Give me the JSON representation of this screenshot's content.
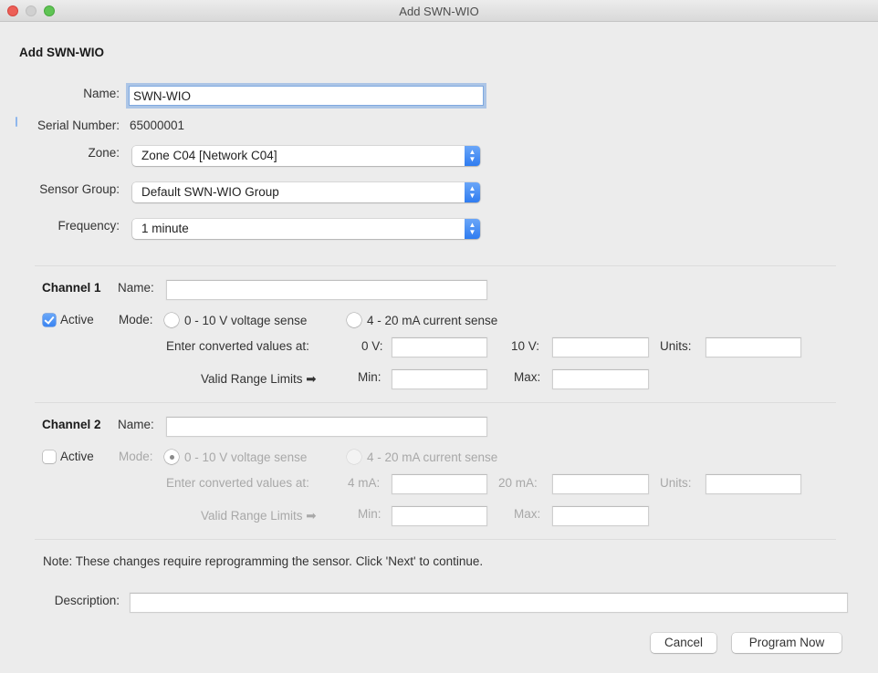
{
  "window": {
    "title": "Add SWN-WIO",
    "controls": [
      "close",
      "minimize",
      "zoom"
    ]
  },
  "heading": "Add SWN-WIO",
  "form": {
    "name": {
      "label": "Name:",
      "value": "SWN-WIO"
    },
    "serial_number": {
      "label": "Serial Number:",
      "value": "65000001"
    },
    "zone": {
      "label": "Zone:",
      "selected": "Zone C04 [Network C04]"
    },
    "sensor_group": {
      "label": "Sensor Group:",
      "selected": "Default SWN-WIO Group"
    },
    "frequency": {
      "label": "Frequency:",
      "selected": "1 minute"
    },
    "select_arrows_glyph": "⌃⌄"
  },
  "channels": [
    {
      "title": "Channel 1",
      "name_label": "Name:",
      "name_value": "",
      "active_label": "Active",
      "active": true,
      "mode_label": "Mode:",
      "modes": [
        {
          "label": "0 - 10 V voltage sense",
          "selected": false
        },
        {
          "label": "4 - 20 mA current sense",
          "selected": false
        }
      ],
      "converted_label": "Enter converted values at:",
      "low_label": "0 V:",
      "low_value": "",
      "high_label": "10 V:",
      "high_value": "",
      "units_label": "Units:",
      "units_value": "",
      "range_label": "Valid Range Limits ➡",
      "min_label": "Min:",
      "min_value": "",
      "max_label": "Max:",
      "max_value": "",
      "enabled": true
    },
    {
      "title": "Channel 2",
      "name_label": "Name:",
      "name_value": "",
      "active_label": "Active",
      "active": false,
      "mode_label": "Mode:",
      "modes": [
        {
          "label": "0 - 10 V voltage sense",
          "selected": true
        },
        {
          "label": "4 - 20 mA current sense",
          "selected": false
        }
      ],
      "converted_label": "Enter converted values at:",
      "low_label": "4 mA:",
      "low_value": "",
      "high_label": "20 mA:",
      "high_value": "",
      "units_label": "Units:",
      "units_value": "",
      "range_label": "Valid Range Limits ➡",
      "min_label": "Min:",
      "min_value": "",
      "max_label": "Max:",
      "max_value": "",
      "enabled": false
    }
  ],
  "note": "Note: These changes require reprogramming the sensor. Click 'Next' to continue.",
  "description": {
    "label": "Description:",
    "value": ""
  },
  "buttons": {
    "cancel": "Cancel",
    "program_now": "Program Now"
  },
  "colors": {
    "accent": "#3a84f2",
    "focus_ring": "#7fa9e0",
    "background": "#ececec"
  }
}
